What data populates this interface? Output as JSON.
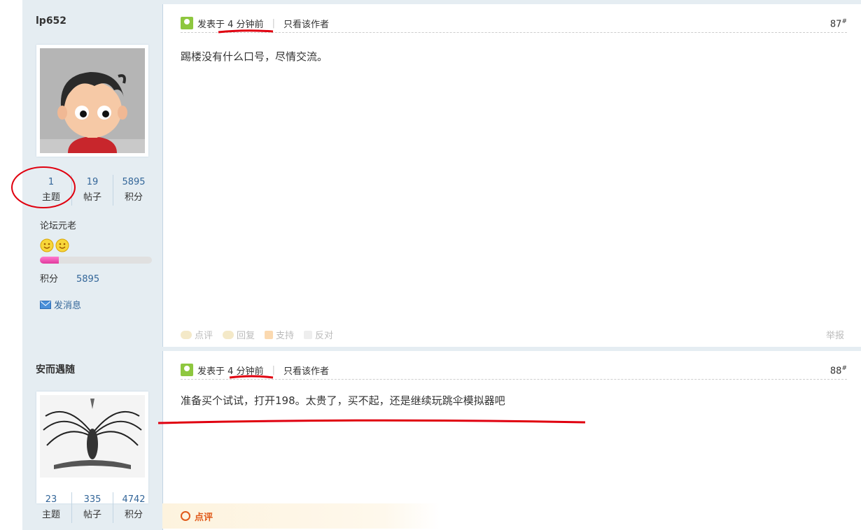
{
  "posts": [
    {
      "username": "lp652",
      "stats": [
        {
          "num": "1",
          "label": "主题"
        },
        {
          "num": "19",
          "label": "帖子"
        },
        {
          "num": "5895",
          "label": "积分"
        }
      ],
      "rank": "论坛元老",
      "progress": 0.17,
      "score_label": "积分",
      "score_value": "5895",
      "message_label": "发消息",
      "posted_prefix": "发表于",
      "posted_time": "4 分钟前",
      "only_author": "只看该作者",
      "floor": "87",
      "floor_mark": "#",
      "text": "踢楼没有什么口号，尽情交流。",
      "actions": [
        "点评",
        "回复",
        "支持",
        "反对"
      ],
      "report": "举报"
    },
    {
      "username": "安而遇随",
      "stats": [
        {
          "num": "23",
          "label": "主题"
        },
        {
          "num": "335",
          "label": "帖子"
        },
        {
          "num": "4742",
          "label": "积分"
        }
      ],
      "posted_prefix": "发表于",
      "posted_time": "4 分钟前",
      "only_author": "只看该作者",
      "floor": "88",
      "floor_mark": "#",
      "text": "准备买个试试，打开198。太贵了，买不起，还是继续玩跳伞模拟器吧",
      "comment_label": "点评"
    }
  ],
  "colors": {
    "annotation": "#e0000f",
    "link": "#336699",
    "sidebar_bg": "#e5edf2"
  }
}
